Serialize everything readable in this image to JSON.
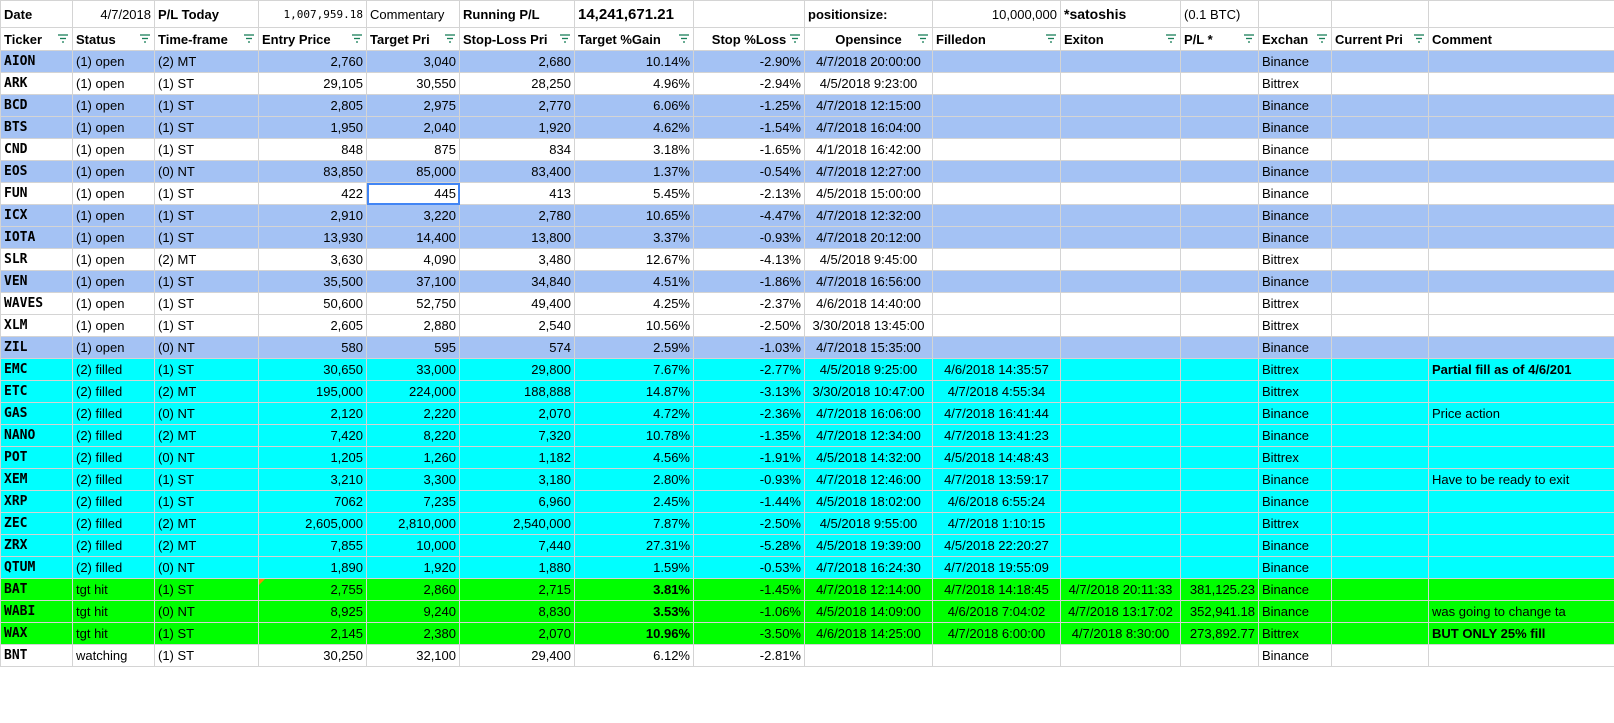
{
  "top": {
    "date_label": "Date",
    "date_value": "4/7/2018",
    "pl_today_label": "P/L Today",
    "pl_today_value": "1,007,959.18",
    "commentary_label": "Commentary",
    "running_pl_label": "Running P/L",
    "running_pl_value": "14,241,671.21",
    "positionsize_label": "positionsize:",
    "positionsize_value": "10,000,000",
    "unit_label": "*satoshis",
    "btc_label": "(0.1 BTC)"
  },
  "headers": [
    "Ticker",
    "Status",
    "Time-frame",
    "Entry Price",
    "Target Pri",
    "Stop-Loss Pri",
    "Target %Gain",
    "Stop %Loss",
    "Opensince",
    "Filledon",
    "Exiton",
    "P/L *",
    "Exchan",
    "Current Pri",
    "Comment"
  ],
  "rows": [
    {
      "cls": "open1",
      "cells": [
        "AION",
        "(1) open",
        "(2) MT",
        "2,760",
        "3,040",
        "2,680",
        "10.14%",
        "-2.90%",
        "4/7/2018 20:00:00",
        "",
        "",
        "",
        "Binance",
        "",
        ""
      ]
    },
    {
      "cls": "open2",
      "cells": [
        "ARK",
        "(1) open",
        "(1) ST",
        "29,105",
        "30,550",
        "28,250",
        "4.96%",
        "-2.94%",
        "4/5/2018 9:23:00",
        "",
        "",
        "",
        "Bittrex",
        "",
        ""
      ]
    },
    {
      "cls": "open1",
      "cells": [
        "BCD",
        "(1) open",
        "(1) ST",
        "2,805",
        "2,975",
        "2,770",
        "6.06%",
        "-1.25%",
        "4/7/2018 12:15:00",
        "",
        "",
        "",
        "Binance",
        "",
        ""
      ]
    },
    {
      "cls": "open1",
      "cells": [
        "BTS",
        "(1) open",
        "(1) ST",
        "1,950",
        "2,040",
        "1,920",
        "4.62%",
        "-1.54%",
        "4/7/2018 16:04:00",
        "",
        "",
        "",
        "Binance",
        "",
        ""
      ]
    },
    {
      "cls": "open2",
      "cells": [
        "CND",
        "(1) open",
        "(1) ST",
        "848",
        "875",
        "834",
        "3.18%",
        "-1.65%",
        "4/1/2018 16:42:00",
        "",
        "",
        "",
        "Binance",
        "",
        ""
      ]
    },
    {
      "cls": "open1",
      "cells": [
        "EOS",
        "(1) open",
        "(0) NT",
        "83,850",
        "85,000",
        "83,400",
        "1.37%",
        "-0.54%",
        "4/7/2018 12:27:00",
        "",
        "",
        "",
        "Binance",
        "",
        ""
      ]
    },
    {
      "cls": "open2",
      "cells": [
        "FUN",
        "(1) open",
        "(1) ST",
        "422",
        "445",
        "413",
        "5.45%",
        "-2.13%",
        "4/5/2018 15:00:00",
        "",
        "",
        "",
        "Binance",
        "",
        ""
      ]
    },
    {
      "cls": "open1",
      "cells": [
        "ICX",
        "(1) open",
        "(1) ST",
        "2,910",
        "3,220",
        "2,780",
        "10.65%",
        "-4.47%",
        "4/7/2018 12:32:00",
        "",
        "",
        "",
        "Binance",
        "",
        ""
      ]
    },
    {
      "cls": "open1",
      "cells": [
        "IOTA",
        "(1) open",
        "(1) ST",
        "13,930",
        "14,400",
        "13,800",
        "3.37%",
        "-0.93%",
        "4/7/2018 20:12:00",
        "",
        "",
        "",
        "Binance",
        "",
        ""
      ]
    },
    {
      "cls": "open2",
      "cells": [
        "SLR",
        "(1) open",
        "(2) MT",
        "3,630",
        "4,090",
        "3,480",
        "12.67%",
        "-4.13%",
        "4/5/2018 9:45:00",
        "",
        "",
        "",
        "Bittrex",
        "",
        ""
      ]
    },
    {
      "cls": "open1",
      "cells": [
        "VEN",
        "(1) open",
        "(1) ST",
        "35,500",
        "37,100",
        "34,840",
        "4.51%",
        "-1.86%",
        "4/7/2018 16:56:00",
        "",
        "",
        "",
        "Binance",
        "",
        ""
      ]
    },
    {
      "cls": "open2",
      "cells": [
        "WAVES",
        "(1) open",
        "(1) ST",
        "50,600",
        "52,750",
        "49,400",
        "4.25%",
        "-2.37%",
        "4/6/2018 14:40:00",
        "",
        "",
        "",
        "Bittrex",
        "",
        ""
      ]
    },
    {
      "cls": "open2",
      "cells": [
        "XLM",
        "(1) open",
        "(1) ST",
        "2,605",
        "2,880",
        "2,540",
        "10.56%",
        "-2.50%",
        "3/30/2018 13:45:00",
        "",
        "",
        "",
        "Bittrex",
        "",
        ""
      ]
    },
    {
      "cls": "open1",
      "cells": [
        "ZIL",
        "(1) open",
        "(0) NT",
        "580",
        "595",
        "574",
        "2.59%",
        "-1.03%",
        "4/7/2018 15:35:00",
        "",
        "",
        "",
        "Binance",
        "",
        ""
      ]
    },
    {
      "cls": "filled",
      "cells": [
        "EMC",
        "(2) filled",
        "(1) ST",
        "30,650",
        "33,000",
        "29,800",
        "7.67%",
        "-2.77%",
        "4/5/2018 9:25:00",
        "4/6/2018 14:35:57",
        "",
        "",
        "Bittrex",
        "",
        "Partial fill as of 4/6/201"
      ]
    },
    {
      "cls": "filled",
      "cells": [
        "ETC",
        "(2) filled",
        "(2) MT",
        "195,000",
        "224,000",
        "188,888",
        "14.87%",
        "-3.13%",
        "3/30/2018 10:47:00",
        "4/7/2018 4:55:34",
        "",
        "",
        "Bittrex",
        "",
        ""
      ]
    },
    {
      "cls": "filled",
      "cells": [
        "GAS",
        "(2) filled",
        "(0) NT",
        "2,120",
        "2,220",
        "2,070",
        "4.72%",
        "-2.36%",
        "4/7/2018 16:06:00",
        "4/7/2018 16:41:44",
        "",
        "",
        "Binance",
        "",
        "Price action"
      ]
    },
    {
      "cls": "filled",
      "cells": [
        "NANO",
        "(2) filled",
        "(2) MT",
        "7,420",
        "8,220",
        "7,320",
        "10.78%",
        "-1.35%",
        "4/7/2018 12:34:00",
        "4/7/2018 13:41:23",
        "",
        "",
        "Binance",
        "",
        ""
      ]
    },
    {
      "cls": "filled",
      "cells": [
        "POT",
        "(2) filled",
        "(0) NT",
        "1,205",
        "1,260",
        "1,182",
        "4.56%",
        "-1.91%",
        "4/5/2018 14:32:00",
        "4/5/2018 14:48:43",
        "",
        "",
        "Bittrex",
        "",
        ""
      ]
    },
    {
      "cls": "filled",
      "cells": [
        "XEM",
        "(2) filled",
        "(1) ST",
        "3,210",
        "3,300",
        "3,180",
        "2.80%",
        "-0.93%",
        "4/7/2018 12:46:00",
        "4/7/2018 13:59:17",
        "",
        "",
        "Binance",
        "",
        "Have to be ready to exit"
      ]
    },
    {
      "cls": "filled",
      "cells": [
        "XRP",
        "(2) filled",
        "(1) ST",
        "7062",
        "7,235",
        "6,960",
        "2.45%",
        "-1.44%",
        "4/5/2018 18:02:00",
        "4/6/2018 6:55:24",
        "",
        "",
        "Binance",
        "",
        ""
      ]
    },
    {
      "cls": "filled",
      "cells": [
        "ZEC",
        "(2) filled",
        "(2) MT",
        "2,605,000",
        "2,810,000",
        "2,540,000",
        "7.87%",
        "-2.50%",
        "4/5/2018 9:55:00",
        "4/7/2018 1:10:15",
        "",
        "",
        "Bittrex",
        "",
        ""
      ]
    },
    {
      "cls": "filled",
      "cells": [
        "ZRX",
        "(2) filled",
        "(2) MT",
        "7,855",
        "10,000",
        "7,440",
        "27.31%",
        "-5.28%",
        "4/5/2018 19:39:00",
        "4/5/2018 22:20:27",
        "",
        "",
        "Binance",
        "",
        ""
      ]
    },
    {
      "cls": "filled",
      "cells": [
        "QTUM",
        "(2) filled",
        "(0) NT",
        "1,890",
        "1,920",
        "1,880",
        "1.59%",
        "-0.53%",
        "4/7/2018 16:24:30",
        "4/7/2018 19:55:09",
        "",
        "",
        "Binance",
        "",
        ""
      ]
    },
    {
      "cls": "tgt",
      "cells": [
        "BAT",
        "tgt hit",
        "(1) ST",
        "2,755",
        "2,860",
        "2,715",
        "3.81%",
        "-1.45%",
        "4/7/2018 12:14:00",
        "4/7/2018 14:18:45",
        "4/7/2018 20:11:33",
        "381,125.23",
        "Binance",
        "",
        ""
      ]
    },
    {
      "cls": "tgt",
      "cells": [
        "WABI",
        "tgt hit",
        "(0) NT",
        "8,925",
        "9,240",
        "8,830",
        "3.53%",
        "-1.06%",
        "4/5/2018 14:09:00",
        "4/6/2018 7:04:02",
        "4/7/2018 13:17:02",
        "352,941.18",
        "Binance",
        "",
        "was going to change  ta"
      ]
    },
    {
      "cls": "tgt",
      "cells": [
        "WAX",
        "tgt hit",
        "(1) ST",
        "2,145",
        "2,380",
        "2,070",
        "10.96%",
        "-3.50%",
        "4/6/2018 14:25:00",
        "4/7/2018 6:00:00",
        "4/7/2018 8:30:00",
        "273,892.77",
        "Bittrex",
        "",
        "BUT ONLY 25% fill"
      ]
    },
    {
      "cls": "watch",
      "cells": [
        "BNT",
        "watching",
        "(1) ST",
        "30,250",
        "32,100",
        "29,400",
        "6.12%",
        "-2.81%",
        "",
        "",
        "",
        "",
        "Binance",
        "",
        ""
      ]
    }
  ]
}
